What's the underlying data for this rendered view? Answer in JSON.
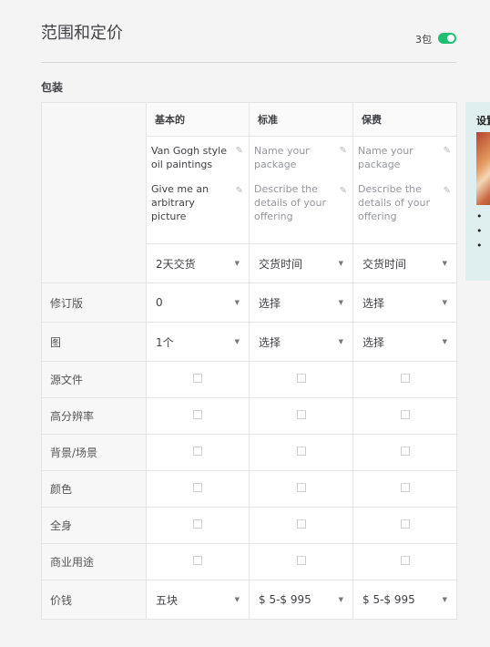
{
  "page": {
    "title": "范围和定价",
    "package_count": "3包",
    "toggle_on": true,
    "accent": "#1dbf73"
  },
  "section_label": "包装",
  "tiers": [
    {
      "name": "基本的",
      "package_name": "Van Gogh style oil paintings",
      "description": "Give me an arbitrary picture",
      "delivery": "2天交货",
      "revisions": "0",
      "figures": "1个",
      "price": "五块"
    },
    {
      "name": "标准",
      "package_name": "Name your package",
      "description": "Describe the details of your offering",
      "delivery": "交货时间",
      "revisions": "选择",
      "figures": "选择",
      "price": "$ 5-$ 995"
    },
    {
      "name": "保费",
      "package_name": "Name your package",
      "description": "Describe the details of your offering",
      "delivery": "交货时间",
      "revisions": "选择",
      "figures": "选择",
      "price": "$ 5-$ 995"
    }
  ],
  "row_labels": {
    "revisions": "修订版",
    "figures": "图",
    "price": "价钱",
    "features": [
      "源文件",
      "高分辨率",
      "背景/场景",
      "颜色",
      "全身",
      "商业用途"
    ]
  },
  "side_panel": {
    "title": "设置",
    "bullets": [
      "•",
      "•",
      "•"
    ]
  },
  "icons": {
    "pencil": "pencil-icon",
    "caret": "caret-down-icon",
    "checkbox": "checkbox"
  }
}
